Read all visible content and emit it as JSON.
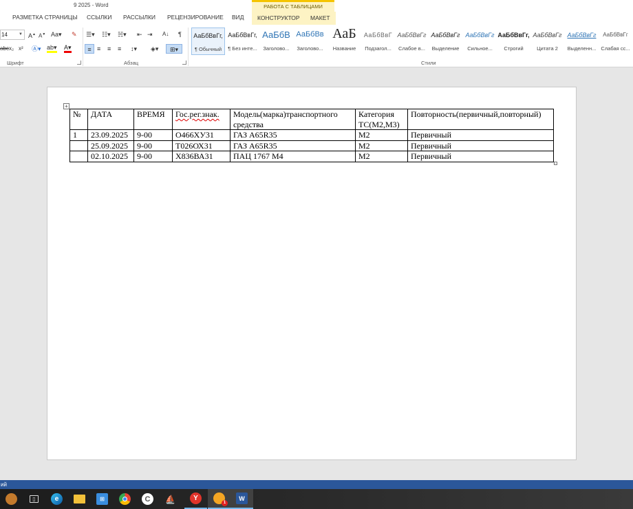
{
  "window": {
    "title": "9 2025 - Word",
    "context_header": "РАБОТА С ТАБЛИЦАМИ"
  },
  "tabs": [
    {
      "label": "РАЗМЕТКА СТРАНИЦЫ"
    },
    {
      "label": "ССЫЛКИ"
    },
    {
      "label": "РАССЫЛКИ"
    },
    {
      "label": "РЕЦЕНЗИРОВАНИЕ"
    },
    {
      "label": "ВИД"
    },
    {
      "label": "КОНСТРУКТОР"
    },
    {
      "label": "МАКЕТ"
    }
  ],
  "ribbon": {
    "font_size": "14",
    "groups": {
      "font": "Шрифт",
      "paragraph": "Абзац",
      "styles": "Стили"
    },
    "styles": [
      {
        "sample": "АаБбВвГг,",
        "name": "¶ Обычный"
      },
      {
        "sample": "АаБбВвГг,",
        "name": "¶ Без инте..."
      },
      {
        "sample": "АаБбВ",
        "name": "Заголово..."
      },
      {
        "sample": "АаБбВв",
        "name": "Заголово..."
      },
      {
        "sample": "АаБ",
        "name": "Название"
      },
      {
        "sample": "АаБбВвГ",
        "name": "Подзагол..."
      },
      {
        "sample": "АаБбВвГг",
        "name": "Слабое в..."
      },
      {
        "sample": "АаБбВвГг",
        "name": "Выделение"
      },
      {
        "sample": "АаБбВвГг",
        "name": "Сильное..."
      },
      {
        "sample": "АаБбВвГг,",
        "name": "Строгий"
      },
      {
        "sample": "АаБбВвГг",
        "name": "Цитата 2"
      },
      {
        "sample": "АаБбВвГг",
        "name": "Выделенн..."
      },
      {
        "sample": "АаБбВвГг",
        "name": "Слабая сс..."
      }
    ]
  },
  "document": {
    "table": {
      "headers": [
        "№",
        "ДАТА",
        "ВРЕМЯ",
        "Гос.рег.знак.",
        "Модель(марка)транспортного средства",
        "Категория ТС(М2,М3)",
        "Повторность(первичный,повторный)"
      ],
      "rows": [
        [
          "1",
          "23.09.2025",
          "9-00",
          "О466ХУ31",
          "ГАЗ А65R35",
          "М2",
          "Первичный"
        ],
        [
          "",
          "25.09.2025",
          "9-00",
          "Т026ОХ31",
          "ГАЗ А65R35",
          "М2",
          "Первичный"
        ],
        [
          "",
          "02.10.2025",
          "9-00",
          "Х836ВА31",
          "ПАЦ 1767 М4",
          "М2",
          "Первичный"
        ]
      ]
    }
  },
  "statusbar": {
    "language": "ий"
  },
  "taskbar": {
    "icons": [
      "tray-squirrel-icon",
      "task-view-icon",
      "edge-icon",
      "file-explorer-icon",
      "store-icon",
      "chrome-icon",
      "yandex-c-icon",
      "dock-icon",
      "yandex-browser-icon",
      "notification-app-icon",
      "word-icon"
    ],
    "badge_count": "1"
  }
}
